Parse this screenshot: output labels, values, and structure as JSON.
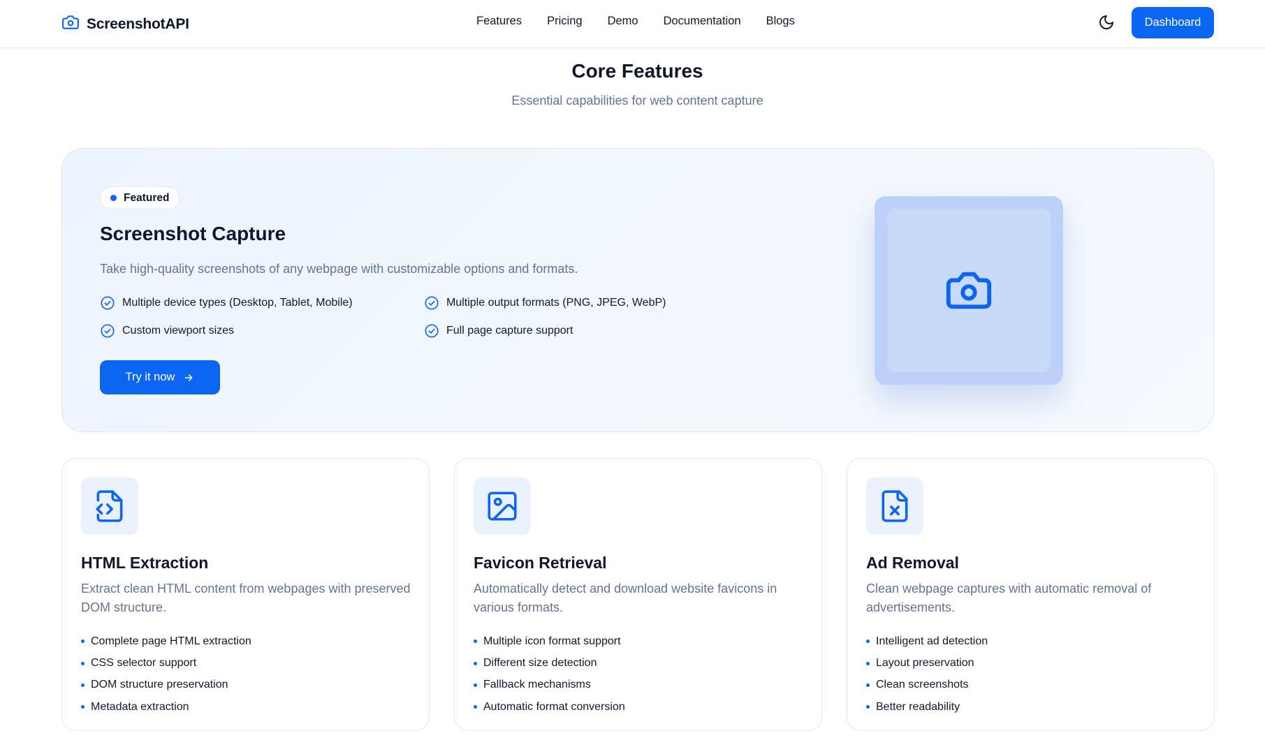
{
  "brand": {
    "name": "ScreenshotAPI",
    "icon": "camera-icon"
  },
  "nav": {
    "links": [
      "Features",
      "Pricing",
      "Demo",
      "Documentation",
      "Blogs"
    ],
    "theme_icon": "moon-icon",
    "dashboard_label": "Dashboard"
  },
  "section": {
    "title": "Core Features",
    "subtitle": "Essential capabilities for web content capture"
  },
  "featured": {
    "badge": "Featured",
    "title": "Screenshot Capture",
    "description": "Take high-quality screenshots of any webpage with customizable options and formats.",
    "items": [
      "Multiple device types (Desktop, Tablet, Mobile)",
      "Multiple output formats (PNG, JPEG, WebP)",
      "Custom viewport sizes",
      "Full page capture support"
    ],
    "button_label": "Try it now",
    "illustration_icon": "camera-icon"
  },
  "cards": [
    {
      "icon": "file-code-icon",
      "title": "HTML Extraction",
      "description": "Extract clean HTML content from webpages with preserved DOM structure.",
      "items": [
        "Complete page HTML extraction",
        "CSS selector support",
        "DOM structure preservation",
        "Metadata extraction"
      ]
    },
    {
      "icon": "image-icon",
      "title": "Favicon Retrieval",
      "description": "Automatically detect and download website favicons in various formats.",
      "items": [
        "Multiple icon format support",
        "Different size detection",
        "Fallback mechanisms",
        "Automatic format conversion"
      ]
    },
    {
      "icon": "file-x-icon",
      "title": "Ad Removal",
      "description": "Clean webpage captures with automatic removal of advertisements.",
      "items": [
        "Intelligent ad detection",
        "Layout preservation",
        "Clean screenshots",
        "Better readability"
      ]
    }
  ],
  "colors": {
    "accent": "#0a66f0",
    "muted_text": "#64748b",
    "heading": "#0f172a"
  }
}
